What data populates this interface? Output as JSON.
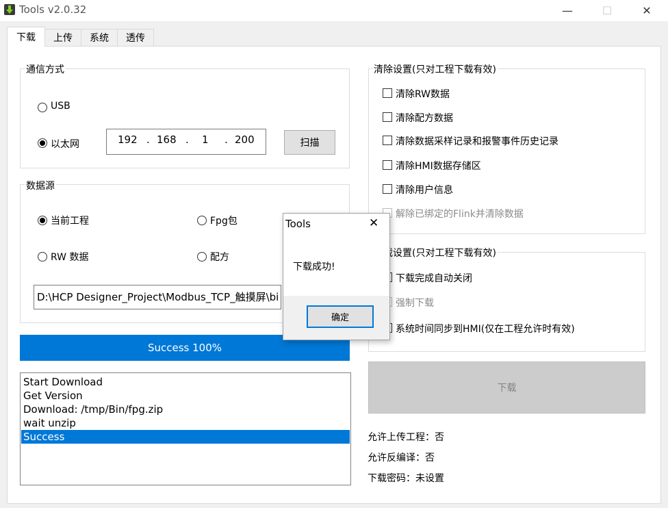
{
  "window": {
    "title": "Tools v2.0.32",
    "min_glyph": "—",
    "max_glyph": "☐",
    "close_glyph": "✕",
    "icon": "download-arrow-icon"
  },
  "tabs": [
    {
      "label": "下载",
      "active": true
    },
    {
      "label": "上传",
      "active": false
    },
    {
      "label": "系统",
      "active": false
    },
    {
      "label": "透传",
      "active": false
    }
  ],
  "comm": {
    "title": "通信方式",
    "usb_label": "USB",
    "usb_selected": false,
    "ethernet_label": "以太网",
    "ethernet_selected": true,
    "ip": [
      "192",
      "168",
      "1",
      "200"
    ],
    "dot": ".",
    "scan_label": "扫描"
  },
  "datasource": {
    "title": "数据源",
    "current_project_label": "当前工程",
    "current_project_selected": true,
    "fpg_label": "Fpg包",
    "rw_label": "RW 数据",
    "recipe_label": "配方",
    "path_value": "D:\\HCP Designer_Project\\Modbus_TCP_触摸屏\\bi"
  },
  "progress": {
    "text": "Success 100%",
    "percent": 100
  },
  "log": {
    "lines": [
      "Start Download",
      "Get  Version",
      "Download: /tmp/Bin/fpg.zip",
      "wait unzip",
      "Success"
    ],
    "selected_index": 4
  },
  "clear_settings": {
    "title": "清除设置(只对工程下载有效)",
    "items": [
      {
        "label": "清除RW数据",
        "checked": false,
        "enabled": true
      },
      {
        "label": "清除配方数据",
        "checked": false,
        "enabled": true
      },
      {
        "label": "清除数据采样记录和报警事件历史记录",
        "checked": false,
        "enabled": true
      },
      {
        "label": "清除HMI数据存储区",
        "checked": false,
        "enabled": true
      },
      {
        "label": "清除用户信息",
        "checked": false,
        "enabled": true
      },
      {
        "label": "解除已绑定的Flink并清除数据",
        "checked": false,
        "enabled": false
      }
    ]
  },
  "download_settings": {
    "title": "下载设置(只对工程下载有效)",
    "items": [
      {
        "label": "下载完成自动关闭",
        "checked": true,
        "enabled": true
      },
      {
        "label": "强制下载",
        "checked": false,
        "enabled": false
      },
      {
        "label": "系统时间同步到HMI(仅在工程允许时有效)",
        "checked": true,
        "enabled": true
      }
    ]
  },
  "download_button": "下载",
  "info": {
    "allow_upload": "允许上传工程：否",
    "allow_decompile": "允许反编译：否",
    "download_password": "下载密码：未设置"
  },
  "dialog": {
    "title": "Tools",
    "close_glyph": "✕",
    "message": "下载成功!",
    "ok_label": "确定"
  },
  "colors": {
    "accent": "#0078d7",
    "window_bg": "#f0f0f0",
    "disabled_text": "#8a8a8a"
  }
}
